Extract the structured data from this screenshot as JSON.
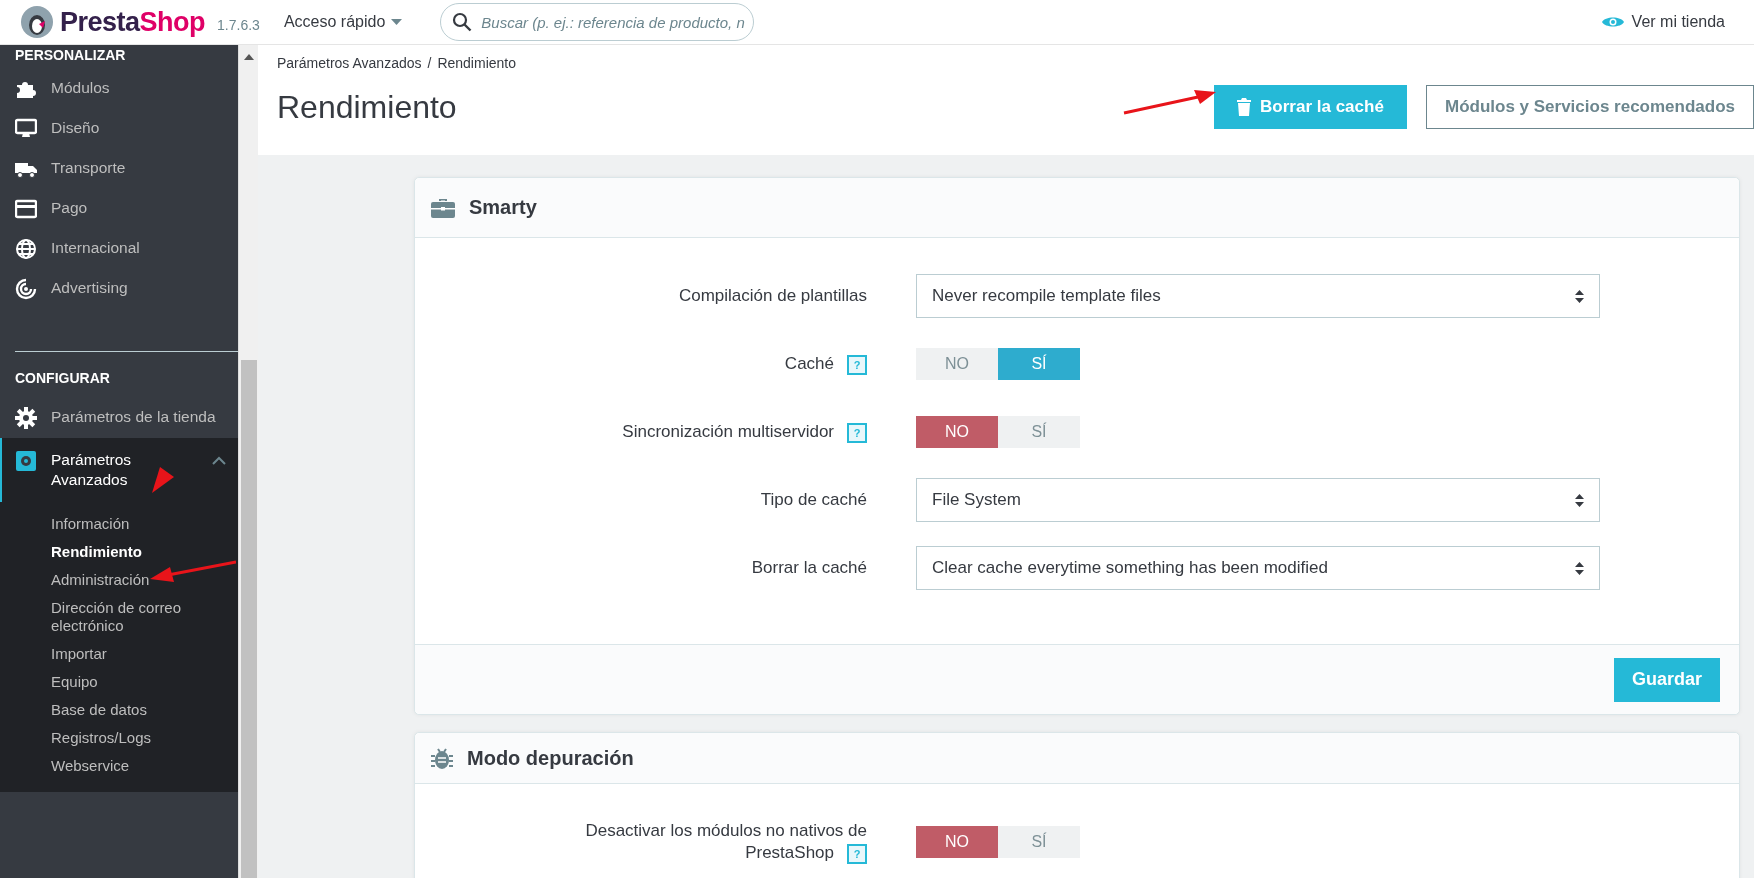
{
  "topbar": {
    "logo": [
      "Presta",
      "Shop"
    ],
    "version": "1.7.6.3",
    "quick_access": "Acceso rápido",
    "search": {
      "placeholder": "Buscar (p. ej.: referencia de producto, n"
    },
    "view_store": "Ver mi tienda"
  },
  "sidebar": {
    "sections": [
      {
        "title": "PERSONALIZAR",
        "items": [
          {
            "label": "Módulos",
            "selected": false
          },
          {
            "label": "Diseño",
            "selected": false
          },
          {
            "label": "Transporte",
            "selected": false
          },
          {
            "label": "Pago",
            "selected": false
          },
          {
            "label": "Internacional",
            "selected": false
          },
          {
            "label": "Advertising",
            "selected": false
          }
        ]
      },
      {
        "title": "CONFIGURAR",
        "items": [
          {
            "label": "Parámetros de la tienda",
            "selected": false
          },
          {
            "label": "Parámetros Avanzados",
            "selected": true,
            "expanded": true,
            "children": [
              {
                "label": "Información",
                "selected": false
              },
              {
                "label": "Rendimiento",
                "selected": true
              },
              {
                "label": "Administración",
                "selected": false
              },
              {
                "label": "Dirección de correo electrónico",
                "selected": false
              },
              {
                "label": "Importar",
                "selected": false
              },
              {
                "label": "Equipo",
                "selected": false
              },
              {
                "label": "Base de datos",
                "selected": false
              },
              {
                "label": "Registros/Logs",
                "selected": false
              },
              {
                "label": "Webservice",
                "selected": false
              }
            ]
          }
        ]
      }
    ]
  },
  "breadcrumb": {
    "items": [
      "Parámetros Avanzados",
      "Rendimiento"
    ],
    "separator": "/"
  },
  "page_title": "Rendimiento",
  "header_buttons": [
    {
      "label": "Borrar la caché",
      "kind": "primary"
    },
    {
      "label": "Módulos y Servicios recomendados",
      "kind": "outline"
    }
  ],
  "panels": [
    {
      "title": "Smarty",
      "fields": [
        {
          "kind": "select",
          "label": "Compilación de plantillas",
          "value": "Never recompile template files"
        },
        {
          "kind": "switch",
          "label": "Caché",
          "help": "?",
          "options": [
            {
              "label": "NO",
              "selected": false
            },
            {
              "label": "SÍ",
              "selected": true
            }
          ]
        },
        {
          "kind": "switch",
          "label": "Sincronización multiservidor",
          "help": "?",
          "options": [
            {
              "label": "NO",
              "selected": true
            },
            {
              "label": "SÍ",
              "selected": false
            }
          ]
        },
        {
          "kind": "select",
          "label": "Tipo de caché",
          "value": "File System"
        },
        {
          "kind": "select",
          "label": "Borrar la caché",
          "value": "Clear cache everytime something has been modified"
        }
      ],
      "save_button": "Guardar"
    },
    {
      "title": "Modo depuración",
      "fields": [
        {
          "kind": "switch",
          "label": "Desactivar los módulos no nativos de PrestaShop",
          "help": "?",
          "options": [
            {
              "label": "NO",
              "selected": true
            },
            {
              "label": "SÍ",
              "selected": false
            }
          ]
        }
      ]
    }
  ]
}
